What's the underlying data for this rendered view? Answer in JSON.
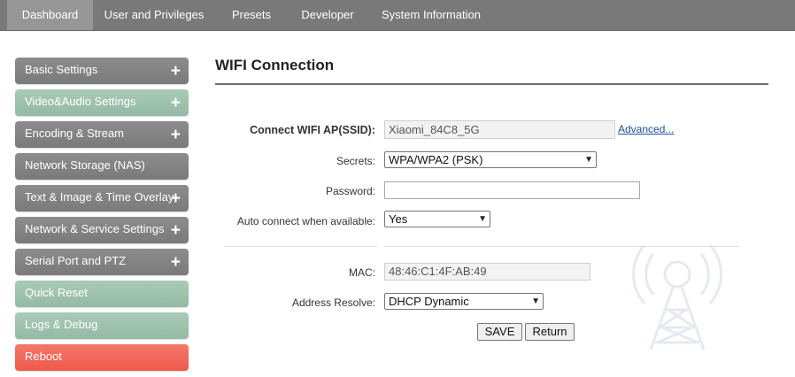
{
  "nav": {
    "tabs": [
      {
        "label": "Dashboard",
        "active": true
      },
      {
        "label": "User and Privileges"
      },
      {
        "label": "Presets"
      },
      {
        "label": "Developer"
      },
      {
        "label": "System Information"
      }
    ]
  },
  "sidebar": {
    "items": [
      {
        "label": "Basic Settings",
        "expand": "+",
        "color": "#888888"
      },
      {
        "label": "Video&Audio Settings",
        "expand": "+",
        "color": "#a3c6b2"
      },
      {
        "label": "Encoding & Stream",
        "expand": "+",
        "color": "#888888"
      },
      {
        "label": "Network Storage (NAS)",
        "color": "#888888"
      },
      {
        "label": "Text & Image & Time Overlay",
        "expand": "+",
        "color": "#888888"
      },
      {
        "label": "Network & Service Settings",
        "expand": "+",
        "color": "#888888"
      },
      {
        "label": "Serial Port and PTZ",
        "expand": "+",
        "color": "#888888"
      },
      {
        "label": "Quick Reset",
        "color": "#a3c6b2"
      },
      {
        "label": "Logs & Debug",
        "color": "#a3c6b2"
      },
      {
        "label": "Reboot",
        "color": "#f06a5d"
      }
    ]
  },
  "content": {
    "title": "WIFI Connection",
    "ssid": {
      "label": "Connect WIFI AP(SSID):",
      "value": "Xiaomi_84C8_5G",
      "advanced": "Advanced..."
    },
    "secrets": {
      "label": "Secrets:",
      "value": "WPA/WPA2 (PSK)"
    },
    "password": {
      "label": "Password:",
      "value": ""
    },
    "auto_connect": {
      "label": "Auto connect when available:",
      "value": "Yes"
    },
    "mac": {
      "label": "MAC:",
      "value": "48:46:C1:4F:AB:49"
    },
    "address_resolve": {
      "label": "Address Resolve:",
      "value": "DHCP Dynamic"
    },
    "buttons": {
      "save": "SAVE",
      "return": "Return"
    }
  },
  "colors": {
    "topbar": "#797979",
    "active_tab": "#969696",
    "link": "#1f4fa0"
  }
}
